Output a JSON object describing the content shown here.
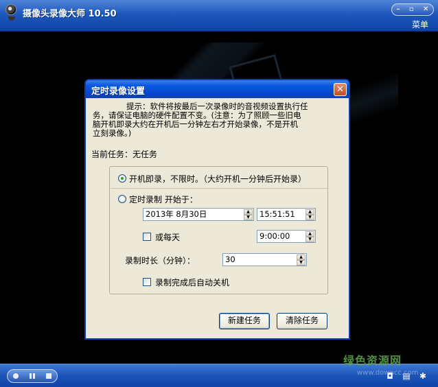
{
  "window": {
    "title": "摄像头录像大师  10.50",
    "menu_label": "菜单",
    "controls": {
      "minimize": "–",
      "maximize": "▫",
      "close": "✕"
    }
  },
  "dialog": {
    "title": "定时录像设置",
    "close_label": "✕",
    "hint_lines": [
      "提示：软件将按最后一次录像时的音视频设置执行任",
      "务，请保证电脑的硬件配置不变。(注意：为了照顾一些旧电",
      "脑开机即录大约在开机后一分钟左右才开始录像，不是开机",
      "立刻录像。)"
    ],
    "current_task": "当前任务：无任务",
    "option_boot": "开机即录，不限时。（大约开机一分钟后开始录）",
    "option_scheduled": "定时录制  开始于：",
    "date_value": "2013年  8月30日",
    "time_value": "15:51:51",
    "daily_label": "或每天",
    "daily_time": "9:00:00",
    "duration_label": "录制时长（分钟）：",
    "duration_value": "30",
    "auto_shutdown_label": "录制完成后自动关机",
    "new_task_button": "新建任务",
    "clear_task_button": "清除任务",
    "selected_option": "boot"
  },
  "bottom": {
    "watermark": "绿色资源网",
    "watermark_url": "www.downcc.com"
  },
  "colors": {
    "titlebar": "#1f58bc",
    "dialog_title": "#0a58e0",
    "dialog_bg": "#ece9d8",
    "watermark": "#5fa84a"
  },
  "icons": [
    "camera-logo-icon",
    "record-icon",
    "pause-icon",
    "stop-icon",
    "snapshot-icon",
    "schedule-icon",
    "settings-icon"
  ]
}
